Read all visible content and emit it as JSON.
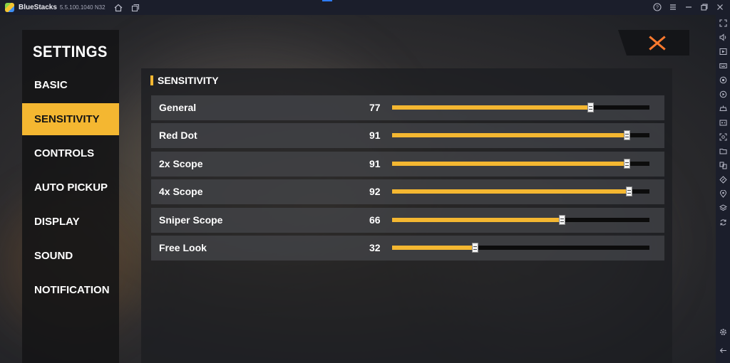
{
  "window": {
    "app_name": "BlueStacks",
    "version": "5.5.100.1040 N32",
    "left_icons": [
      "home-icon",
      "layers-icon"
    ],
    "right_icons": [
      "help-icon",
      "menu-icon",
      "minimize-icon",
      "restore-icon",
      "close-icon"
    ]
  },
  "sidebar_right": {
    "icons": [
      "fullscreen-icon",
      "volume-icon",
      "media-icon",
      "keyboard-icon",
      "record-icon",
      "replay-icon",
      "gamepad-icon",
      "controls-icon",
      "screenshot-icon",
      "folder-icon",
      "multi-instance-icon",
      "eco-icon",
      "location-icon",
      "stack-icon",
      "sync-icon"
    ],
    "bottom_icons": [
      "settings-icon",
      "back-icon"
    ]
  },
  "menu": {
    "title": "SETTINGS",
    "items": [
      {
        "label": "BASIC",
        "active": false
      },
      {
        "label": "SENSITIVITY",
        "active": true
      },
      {
        "label": "CONTROLS",
        "active": false
      },
      {
        "label": "AUTO PICKUP",
        "active": false
      },
      {
        "label": "DISPLAY",
        "active": false
      },
      {
        "label": "SOUND",
        "active": false
      },
      {
        "label": "NOTIFICATION",
        "active": false
      }
    ]
  },
  "panel": {
    "title": "SENSITIVITY",
    "accent": "#f4b731",
    "sliders": [
      {
        "label": "General",
        "value": "77",
        "fraction": 0.77
      },
      {
        "label": "Red Dot",
        "value": "91",
        "fraction": 0.91
      },
      {
        "label": "2x Scope",
        "value": "91",
        "fraction": 0.91
      },
      {
        "label": "4x Scope",
        "value": "92",
        "fraction": 0.92
      },
      {
        "label": "Sniper Scope",
        "value": "66",
        "fraction": 0.66
      },
      {
        "label": "Free Look",
        "value": "32",
        "fraction": 0.32
      }
    ]
  },
  "close": {
    "icon": "close-icon",
    "color": "#ff7a2e"
  }
}
